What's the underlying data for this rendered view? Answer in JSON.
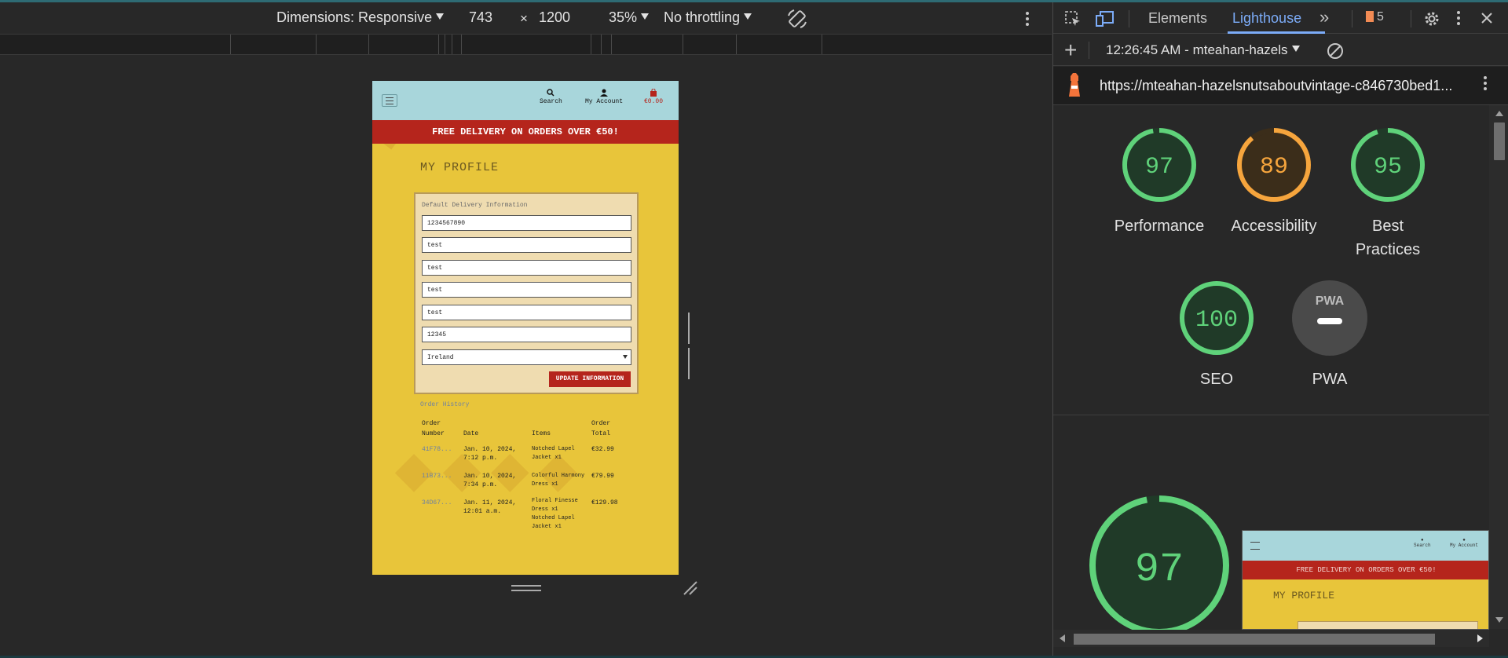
{
  "device_toolbar": {
    "dimensions_label": "Dimensions: Responsive",
    "width": "743",
    "times": "×",
    "height": "1200",
    "zoom": "35%",
    "throttling": "No throttling"
  },
  "emulated_page": {
    "nav": {
      "search": "Search",
      "account": "My Account",
      "cart_total": "€0.00"
    },
    "banner": "FREE DELIVERY ON ORDERS OVER €50!",
    "title": "MY PROFILE",
    "form": {
      "label": "Default Delivery Information",
      "fields": [
        "1234567890",
        "test",
        "test",
        "test",
        "test",
        "12345"
      ],
      "country": "Ireland",
      "submit": "UPDATE INFORMATION"
    },
    "orders": {
      "label": "Order History",
      "headers": {
        "number_l1": "Order",
        "number_l2": "Number",
        "date": "Date",
        "items": "Items",
        "total_l1": "Order",
        "total_l2": "Total"
      },
      "rows": [
        {
          "number": "41F78...",
          "date1": "Jan. 10, 2024,",
          "date2": "7:12 p.m.",
          "items1": "Notched Lapel",
          "items2": "Jacket x1",
          "items3": "",
          "items4": "",
          "total": "€32.99"
        },
        {
          "number": "11B73...",
          "date1": "Jan. 10, 2024,",
          "date2": "7:34 p.m.",
          "items1": "Colorful Harmony",
          "items2": "Dress x1",
          "items3": "",
          "items4": "",
          "total": "€79.99"
        },
        {
          "number": "34D67...",
          "date1": "Jan. 11, 2024,",
          "date2": "12:01 a.m.",
          "items1": "Floral Finesse",
          "items2": "Dress x1",
          "items3": "Notched Lapel",
          "items4": "Jacket x1",
          "total": "€129.98"
        }
      ]
    }
  },
  "devtools": {
    "tabs": {
      "elements": "Elements",
      "lighthouse": "Lighthouse"
    },
    "issues_count": "5",
    "report_label": "12:26:45 AM - mteahan-hazels",
    "url": "https://mteahan-hazelsnutsaboutvintage-c846730bed1...",
    "scores": [
      {
        "value": "97",
        "label": "Performance",
        "color": "#5fd27a",
        "fraction": 0.97
      },
      {
        "value": "89",
        "label": "Accessibility",
        "color": "#f6a53d",
        "fraction": 0.89
      },
      {
        "value": "95",
        "label_l1": "Best",
        "label_l2": "Practices",
        "color": "#5fd27a",
        "fraction": 0.95
      },
      {
        "value": "100",
        "label": "SEO",
        "color": "#5fd27a",
        "fraction": 1.0
      },
      {
        "value": "PWA",
        "label": "PWA",
        "color": "#9e9e9e"
      }
    ],
    "big_score": {
      "value": "97",
      "fraction": 0.97,
      "color": "#5fd27a"
    },
    "thumbnail": {
      "banner": "FREE DELIVERY ON ORDERS OVER €50!",
      "title": "MY PROFILE",
      "search": "Search",
      "account": "My Account"
    }
  }
}
